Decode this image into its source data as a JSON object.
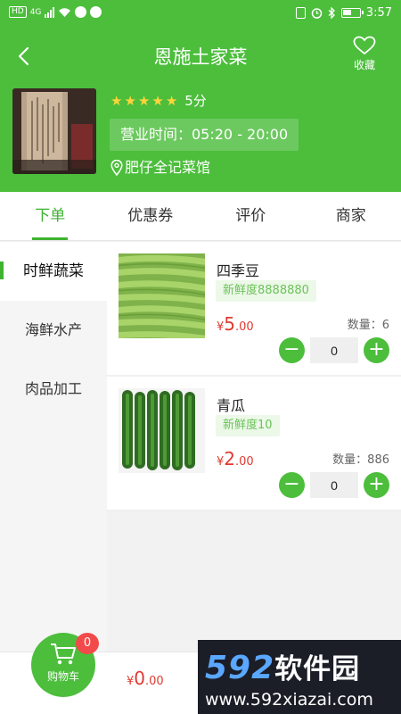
{
  "status_bar": {
    "time": "3:57",
    "network": "4G",
    "hd_label": "HD"
  },
  "header": {
    "title": "恩施土家菜",
    "favorite_label": "收藏",
    "rating_stars": 5,
    "rating_text": "5分",
    "hours_text": "营业时间：05:20 - 20:00",
    "address": "肥仔全记菜馆",
    "accent_color": "#4cbe3c"
  },
  "tabs": [
    {
      "label": "下单",
      "active": true
    },
    {
      "label": "优惠券",
      "active": false
    },
    {
      "label": "评价",
      "active": false
    },
    {
      "label": "商家",
      "active": false
    }
  ],
  "categories": [
    {
      "label": "时鲜蔬菜",
      "active": true
    },
    {
      "label": "海鲜水产",
      "active": false
    },
    {
      "label": "肉品加工",
      "active": false
    }
  ],
  "products": [
    {
      "name": "四季豆",
      "freshness": "新鲜度8888880",
      "currency": "¥",
      "price_int": "5",
      "price_dec": ".00",
      "qty_label": "数量：6",
      "count": "0"
    },
    {
      "name": "青瓜",
      "freshness": "新鲜度10",
      "currency": "¥",
      "price_int": "2",
      "price_dec": ".00",
      "qty_label": "数量：886",
      "count": "0"
    }
  ],
  "cart": {
    "label": "购物车",
    "badge": "0",
    "currency": "¥",
    "total_int": "0",
    "total_dec": ".00"
  },
  "watermark": {
    "brand_num": "592",
    "brand_text": "软件园",
    "url": "www.592xiazai.com"
  }
}
